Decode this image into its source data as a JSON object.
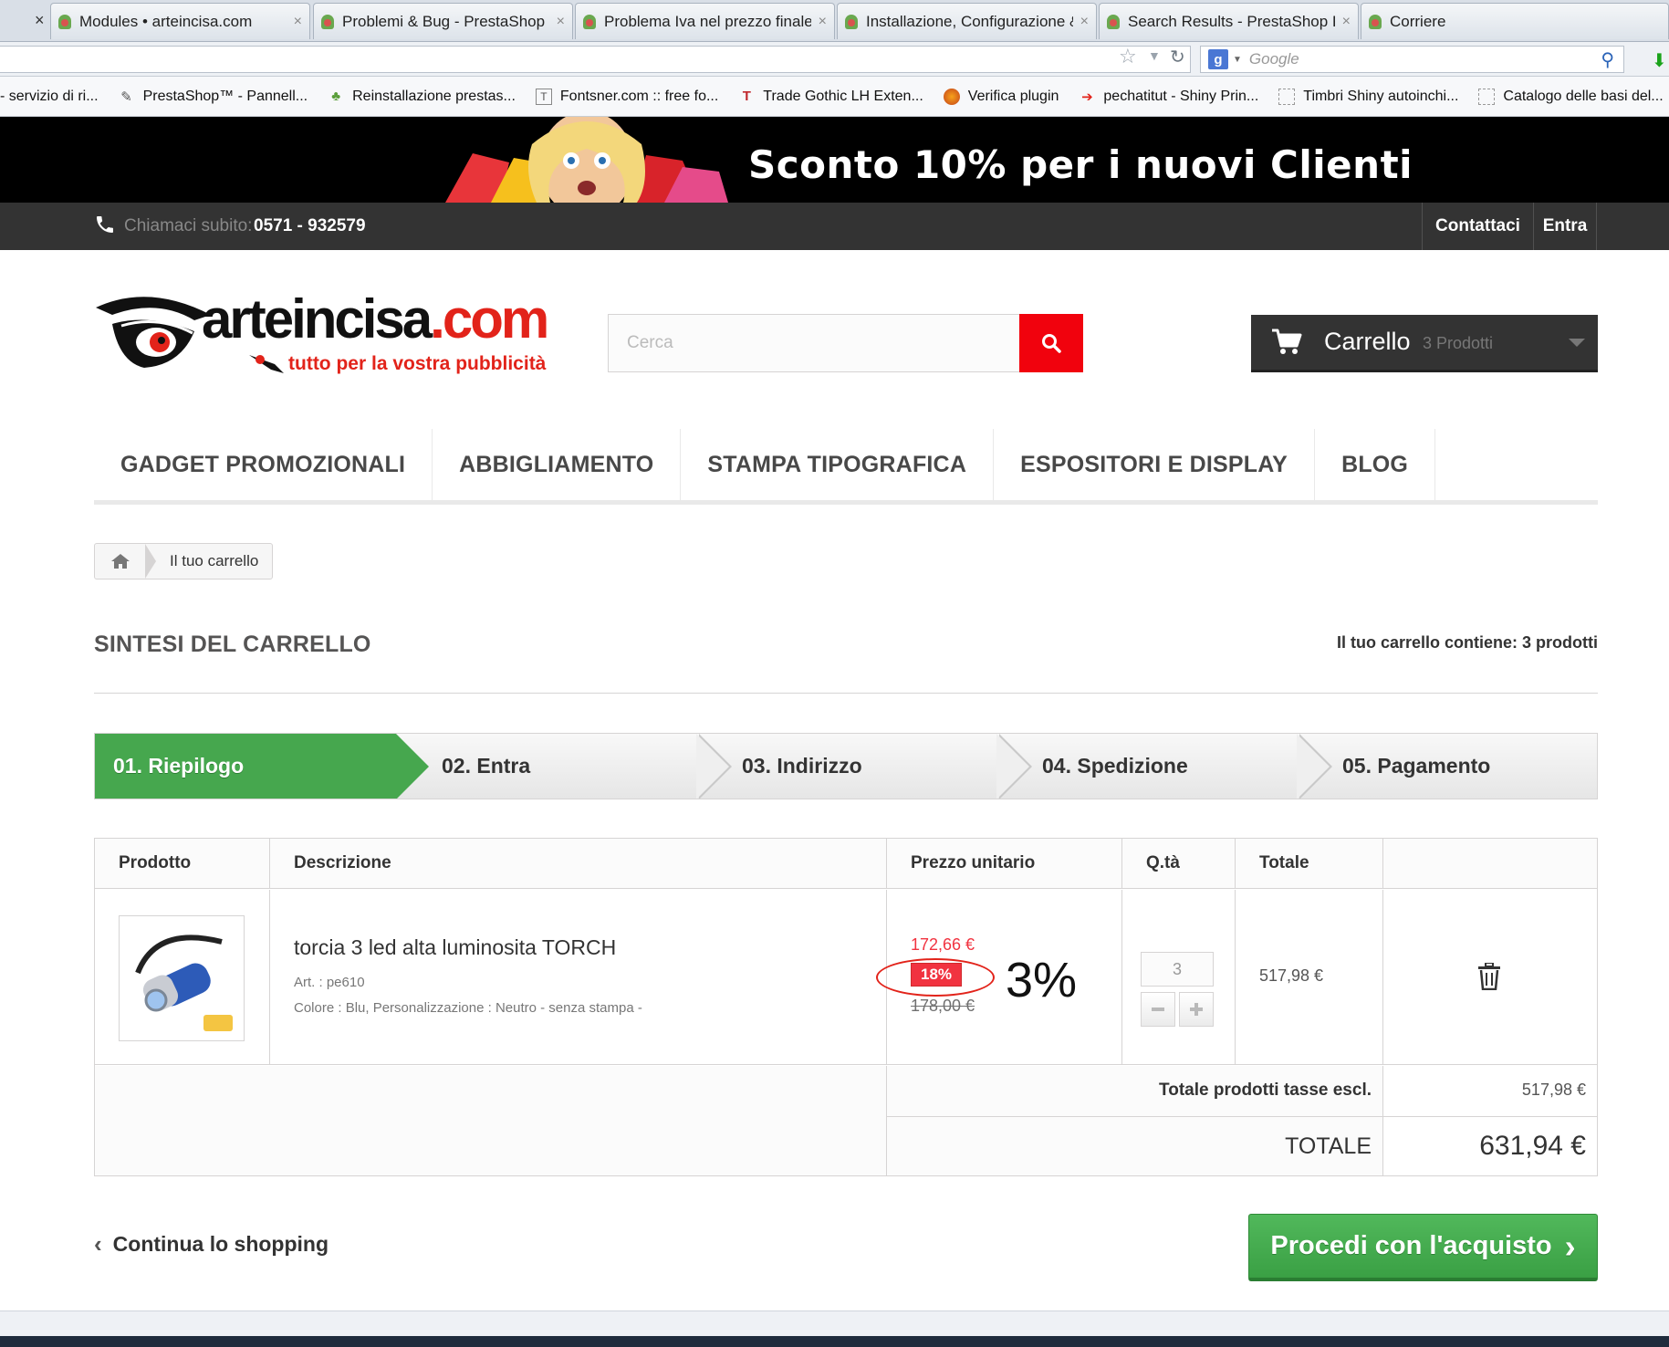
{
  "browser": {
    "tabs": [
      {
        "label": "Modules • arteincisa.com"
      },
      {
        "label": "Problemi & Bug - PrestaShop Foru..."
      },
      {
        "label": "Problema Iva nel prezzo finale - Pro..."
      },
      {
        "label": "Installazione, Configurazione & Ag..."
      },
      {
        "label": "Search Results - PrestaShop Forums"
      },
      {
        "label": "Corriere"
      }
    ],
    "close_glyph": "×",
    "search_placeholder": "Google",
    "bookmarks": [
      {
        "label": "- servizio di ri...",
        "icon": "none"
      },
      {
        "label": "PrestaShop™ - Pannell...",
        "icon": "prestashop-icon"
      },
      {
        "label": "Reinstallazione prestas...",
        "icon": "forum-icon"
      },
      {
        "label": "Fontsner.com :: free fo...",
        "icon": "font-icon"
      },
      {
        "label": "Trade Gothic LH Exten...",
        "icon": "tf-icon"
      },
      {
        "label": "Verifica plugin",
        "icon": "firefox-icon"
      },
      {
        "label": "pechatitut - Shiny Prin...",
        "icon": "arrow-icon"
      },
      {
        "label": "Timbri Shiny autoinchi...",
        "icon": "page-icon"
      },
      {
        "label": "Catalogo delle basi del...",
        "icon": "page-icon"
      }
    ]
  },
  "banner": {
    "text": "Sconto 10% per i nuovi Clienti"
  },
  "topbar": {
    "call_label": "Chiamaci subito:",
    "phone": "0571 - 932579",
    "contact": "Contattaci",
    "login": "Entra"
  },
  "header": {
    "logo_main": "arteincisa",
    "logo_tld": ".com",
    "logo_tagline": "tutto per la vostra pubblicità",
    "search_placeholder": "Cerca",
    "cart_title": "Carrello",
    "cart_count": "3 Prodotti"
  },
  "menu": [
    "GADGET PROMOZIONALI",
    "ABBIGLIAMENTO",
    "STAMPA TIPOGRAFICA",
    "ESPOSITORI E DISPLAY",
    "BLOG"
  ],
  "breadcrumb": {
    "current": "Il tuo carrello"
  },
  "summary": {
    "heading": "SINTESI DEL CARRELLO",
    "contains": "Il tuo carrello contiene: 3 prodotti"
  },
  "steps": [
    "01. Riepilogo",
    "02. Entra",
    "03. Indirizzo",
    "04. Spedizione",
    "05. Pagamento"
  ],
  "table": {
    "headers": [
      "Prodotto",
      "Descrizione",
      "Prezzo unitario",
      "Q.tà",
      "Totale"
    ],
    "row": {
      "name": "torcia 3 led alta luminosita TORCH",
      "ref": "Art. : pe610",
      "attributes": "Colore : Blu, Personalizzazione : Neutro - senza stampa -",
      "price_special": "172,66 €",
      "reduction": "18%",
      "price_old": "178,00 €",
      "annotation": "3%",
      "quantity": "3",
      "total": "517,98 €"
    },
    "subtotal_label": "Totale prodotti tasse escl.",
    "subtotal_value": "517,98 €",
    "total_label": "TOTALE",
    "total_value": "631,94 €"
  },
  "footer": {
    "continue": "Continua lo shopping",
    "checkout": "Procedi con l'acquisto"
  },
  "colors": {
    "accent_red": "#f1020d",
    "step_active": "#46a74e",
    "price_red": "#f13340",
    "dark_bar": "#333333"
  }
}
